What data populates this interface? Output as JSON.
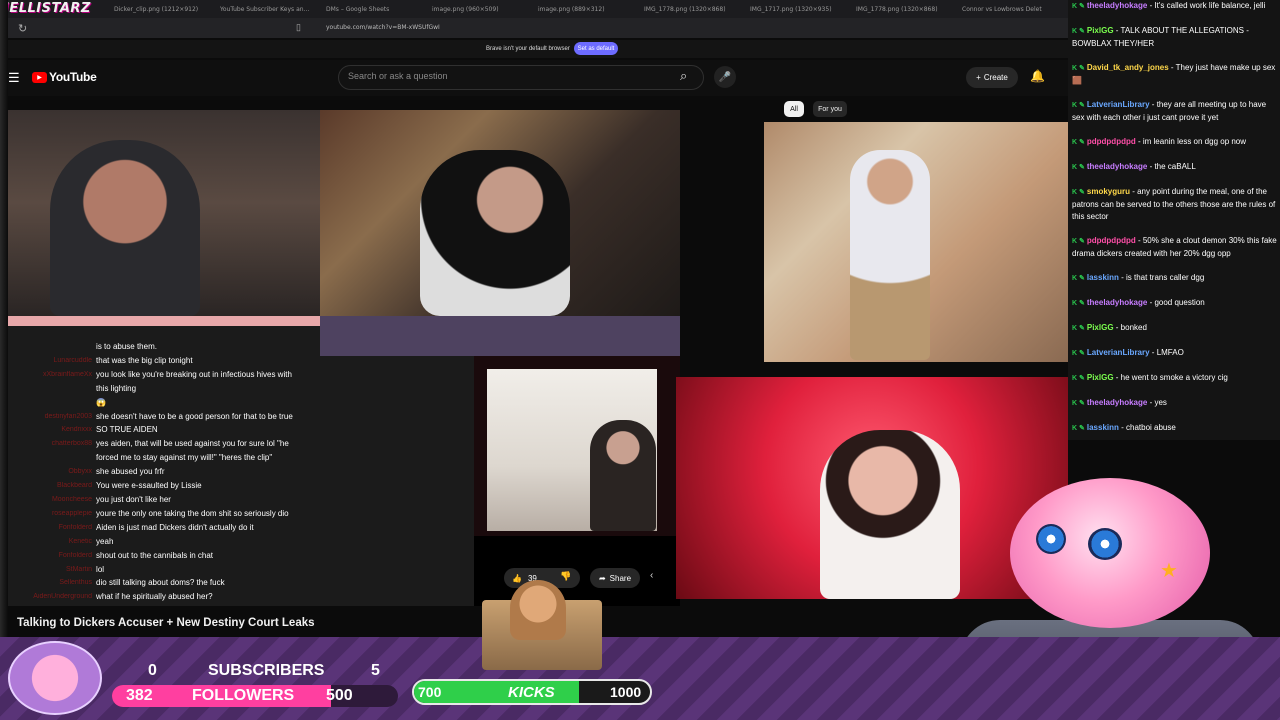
{
  "overlay": {
    "watermark": "JELLISTARZ"
  },
  "browser": {
    "tabs": [
      "Dicker_clip.png (1212×912)",
      "YouTube Subscriber Keys and Pe",
      "DMs – Google Sheets",
      "image.png (960×509)",
      "image.png (889×312)",
      "IMG_1778.png (1320×868)",
      "IMG_1717.png (1320×935)",
      "IMG_1778.png (1320×868)",
      "Connor vs Lowbrows Delet"
    ],
    "url": "youtube.com/watch?v=BM-xWSUfGwI",
    "banner_text": "Brave isn't your default browser",
    "banner_button": "Set as default"
  },
  "youtube": {
    "logo": "YouTube",
    "search_placeholder": "Search or ask a question",
    "create_label": "Create",
    "chips": [
      "All",
      "For you"
    ],
    "like_count": "39",
    "share_label": "Share",
    "video_title": "Talking to Dickers Accuser + New Destiny Court Leaks"
  },
  "clip_chat": [
    {
      "user": "",
      "msg": "is to abuse them."
    },
    {
      "user": "Lunarcuddle",
      "msg": "that was the big clip tonight"
    },
    {
      "user": "xXbrainflameXx",
      "msg": "you look like you're breaking out in infectious hives with"
    },
    {
      "user": "",
      "msg": "this lighting"
    },
    {
      "user": "",
      "msg": "😱"
    },
    {
      "user": "destinyfan2003",
      "msg": "she doesn't have to be a good person for that to be true"
    },
    {
      "user": "Kendrixxx",
      "msg": "SO TRUE AIDEN"
    },
    {
      "user": "chatterbox88",
      "msg": "yes aiden, that will be used against you for sure lol \"he"
    },
    {
      "user": "",
      "msg": "forced me to stay against my will!\" \"heres the clip\""
    },
    {
      "user": "Obbyxx",
      "msg": "she abused you frfr"
    },
    {
      "user": "Blackbeard",
      "msg": "You were e-ssaulted by Lissie"
    },
    {
      "user": "Mooncheese",
      "msg": "you just don't like her"
    },
    {
      "user": "roseapplepie",
      "msg": "youre the only one taking the dom shit so seriously dio"
    },
    {
      "user": "Fonfolderd",
      "msg": "Aiden is just mad Dickers didn't actually do it"
    },
    {
      "user": "Kenetic",
      "msg": "yeah"
    },
    {
      "user": "Fonfolderd",
      "msg": "shout out to the cannibals in chat"
    },
    {
      "user": "StMartin",
      "msg": "lol"
    },
    {
      "user": "Sellenthus",
      "msg": "dio still talking about doms? the fuck"
    },
    {
      "user": "AidenUnderground",
      "msg": "what if he spiritually abused her?"
    }
  ],
  "chat": [
    {
      "name": "theeladyhokage",
      "color": "#c77dff",
      "msg": "It's called work life balance, jelli"
    },
    {
      "name": "PixlGG",
      "color": "#7cff4f",
      "msg": "TALK ABOUT THE ALLEGATIONS - BOWBLAX THEY/HER"
    },
    {
      "name": "David_tk_andy_jones",
      "color": "#ffd84a",
      "msg": "They just have make up sex 🟫"
    },
    {
      "name": "LatverianLibrary",
      "color": "#6aa8ff",
      "msg": "they are all meeting up to have sex with each other i just cant prove it yet"
    },
    {
      "name": "pdpdpdpdpd",
      "color": "#ff4fa8",
      "msg": "im leanin less on dgg op now"
    },
    {
      "name": "theeladyhokage",
      "color": "#c77dff",
      "msg": "the caBALL"
    },
    {
      "name": "smokyguru",
      "color": "#ffd84a",
      "msg": "any point during the meal, one of the patrons can be served to the others those are the rules of this sector"
    },
    {
      "name": "pdpdpdpdpd",
      "color": "#ff4fa8",
      "msg": "50% she a clout demon 30% this fake drama dickers created with her 20% dgg opp"
    },
    {
      "name": "lasskinn",
      "color": "#6aa8ff",
      "msg": "is that trans caller dgg"
    },
    {
      "name": "theeladyhokage",
      "color": "#c77dff",
      "msg": "good question"
    },
    {
      "name": "PixlGG",
      "color": "#7cff4f",
      "msg": "bonked"
    },
    {
      "name": "LatverianLibrary",
      "color": "#6aa8ff",
      "msg": "LMFAO"
    },
    {
      "name": "PixlGG",
      "color": "#7cff4f",
      "msg": "he went to smoke a victory cig"
    },
    {
      "name": "theeladyhokage",
      "color": "#c77dff",
      "msg": "yes"
    },
    {
      "name": "lasskinn",
      "color": "#6aa8ff",
      "msg": "chatboi abuse"
    }
  ],
  "goals": {
    "subscribers": {
      "current": "0",
      "label": "SUBSCRIBERS",
      "goal": "5"
    },
    "followers": {
      "current": "382",
      "label": "FOLLOWERS",
      "goal": "500",
      "progress": 0.764
    },
    "kicks": {
      "current": "700",
      "label": "KICKS",
      "goal": "1000",
      "progress": 0.7
    }
  },
  "icons": {
    "reload": "reload-icon",
    "menu": "menu-icon",
    "search": "search-icon",
    "mic": "mic-icon",
    "bell": "bell-icon"
  }
}
